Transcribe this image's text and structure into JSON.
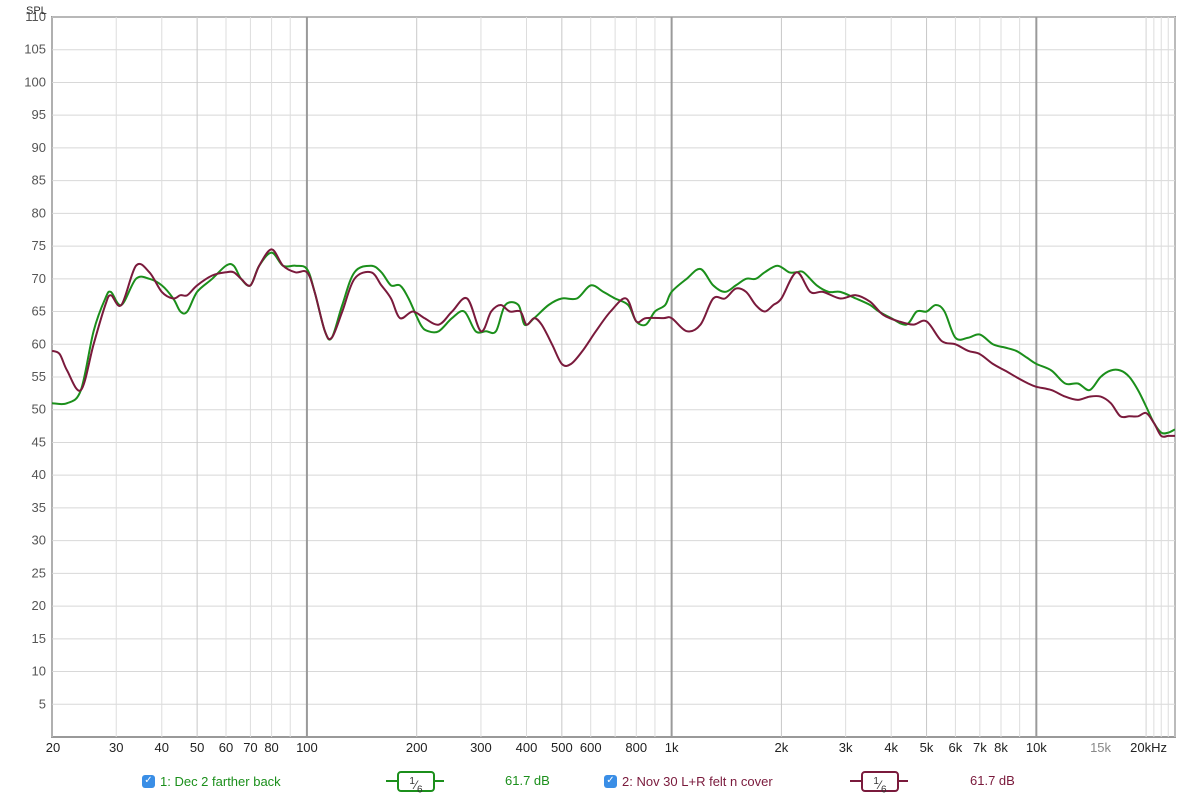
{
  "chart_data": {
    "type": "line",
    "ylabel": "SPL",
    "ylim": [
      0,
      110
    ],
    "xscale": "log",
    "xlim_hz": [
      20,
      20000
    ],
    "y_ticks": [
      "110",
      "105",
      "100",
      "95",
      "90",
      "85",
      "80",
      "75",
      "70",
      "65",
      "60",
      "55",
      "50",
      "45",
      "40",
      "35",
      "30",
      "25",
      "20",
      "15",
      "10",
      "5"
    ],
    "x_ticks": [
      {
        "f": 20,
        "label": "20",
        "minor": false
      },
      {
        "f": 30,
        "label": "30",
        "minor": false
      },
      {
        "f": 40,
        "label": "40",
        "minor": false
      },
      {
        "f": 50,
        "label": "50",
        "minor": false
      },
      {
        "f": 60,
        "label": "60",
        "minor": false
      },
      {
        "f": 70,
        "label": "70",
        "minor": false
      },
      {
        "f": 80,
        "label": "80",
        "minor": false
      },
      {
        "f": 100,
        "label": "100",
        "minor": false
      },
      {
        "f": 200,
        "label": "200",
        "minor": false
      },
      {
        "f": 300,
        "label": "300",
        "minor": false
      },
      {
        "f": 400,
        "label": "400",
        "minor": false
      },
      {
        "f": 500,
        "label": "500",
        "minor": false
      },
      {
        "f": 600,
        "label": "600",
        "minor": false
      },
      {
        "f": 800,
        "label": "800",
        "minor": false
      },
      {
        "f": 1000,
        "label": "1k",
        "minor": false
      },
      {
        "f": 2000,
        "label": "2k",
        "minor": false
      },
      {
        "f": 3000,
        "label": "3k",
        "minor": false
      },
      {
        "f": 4000,
        "label": "4k",
        "minor": false
      },
      {
        "f": 5000,
        "label": "5k",
        "minor": false
      },
      {
        "f": 6000,
        "label": "6k",
        "minor": false
      },
      {
        "f": 7000,
        "label": "7k",
        "minor": false
      },
      {
        "f": 8000,
        "label": "8k",
        "minor": false
      },
      {
        "f": 10000,
        "label": "10k",
        "minor": false
      },
      {
        "f": 15000,
        "label": "15k",
        "minor": true
      },
      {
        "f": 20000,
        "label": "20kHz",
        "minor": false
      }
    ],
    "grid": true,
    "series": [
      {
        "name": "1: Dec 2 farther back",
        "color": "#1b8f1b",
        "points": [
          [
            20,
            51
          ],
          [
            22,
            51
          ],
          [
            24,
            53
          ],
          [
            26,
            62
          ],
          [
            28,
            67
          ],
          [
            29,
            68
          ],
          [
            31,
            66
          ],
          [
            34,
            70
          ],
          [
            37,
            70
          ],
          [
            40,
            69
          ],
          [
            43,
            67
          ],
          [
            45,
            65
          ],
          [
            47,
            65
          ],
          [
            50,
            68
          ],
          [
            55,
            70
          ],
          [
            60,
            72
          ],
          [
            63,
            72
          ],
          [
            66,
            70
          ],
          [
            70,
            69
          ],
          [
            74,
            72
          ],
          [
            80,
            74
          ],
          [
            86,
            72
          ],
          [
            93,
            72
          ],
          [
            100,
            71.5
          ],
          [
            105,
            68
          ],
          [
            112,
            62
          ],
          [
            117,
            61
          ],
          [
            125,
            66
          ],
          [
            135,
            71
          ],
          [
            150,
            72
          ],
          [
            160,
            71
          ],
          [
            170,
            69
          ],
          [
            180,
            69
          ],
          [
            190,
            67
          ],
          [
            205,
            63
          ],
          [
            215,
            62
          ],
          [
            230,
            62
          ],
          [
            250,
            64
          ],
          [
            270,
            65
          ],
          [
            290,
            62
          ],
          [
            310,
            62
          ],
          [
            330,
            62
          ],
          [
            350,
            66
          ],
          [
            380,
            66
          ],
          [
            395,
            63
          ],
          [
            420,
            64
          ],
          [
            460,
            66
          ],
          [
            500,
            67
          ],
          [
            550,
            67
          ],
          [
            600,
            69
          ],
          [
            650,
            68
          ],
          [
            700,
            67
          ],
          [
            760,
            66
          ],
          [
            800,
            63.5
          ],
          [
            850,
            63
          ],
          [
            900,
            65
          ],
          [
            960,
            66
          ],
          [
            1000,
            68
          ],
          [
            1100,
            70
          ],
          [
            1200,
            71.5
          ],
          [
            1300,
            69
          ],
          [
            1400,
            68
          ],
          [
            1500,
            69
          ],
          [
            1600,
            70
          ],
          [
            1700,
            70
          ],
          [
            1800,
            71
          ],
          [
            1950,
            72
          ],
          [
            2100,
            71
          ],
          [
            2200,
            71
          ],
          [
            2300,
            71
          ],
          [
            2500,
            69
          ],
          [
            2700,
            68
          ],
          [
            2900,
            68
          ],
          [
            3200,
            67
          ],
          [
            3500,
            66
          ],
          [
            3700,
            65
          ],
          [
            4000,
            64
          ],
          [
            4400,
            63
          ],
          [
            4700,
            65
          ],
          [
            5000,
            65
          ],
          [
            5300,
            66
          ],
          [
            5600,
            65
          ],
          [
            6000,
            61
          ],
          [
            6500,
            61
          ],
          [
            7000,
            61.5
          ],
          [
            7600,
            60
          ],
          [
            8200,
            59.5
          ],
          [
            8800,
            59
          ],
          [
            9400,
            58
          ],
          [
            10000,
            57
          ],
          [
            11000,
            56
          ],
          [
            12000,
            54
          ],
          [
            13000,
            54
          ],
          [
            14000,
            53
          ],
          [
            15000,
            55
          ],
          [
            16000,
            56
          ],
          [
            17000,
            56
          ],
          [
            18000,
            55
          ],
          [
            19000,
            53
          ],
          [
            20000,
            50.5
          ],
          [
            21000,
            48
          ],
          [
            22000,
            46.5
          ],
          [
            23000,
            46.5
          ],
          [
            24000,
            47
          ]
        ]
      },
      {
        "name": "2: Nov 30 L+R felt n cover",
        "color": "#7a1a3c",
        "points": [
          [
            20,
            59
          ],
          [
            21,
            58.5
          ],
          [
            22,
            56
          ],
          [
            24,
            53
          ],
          [
            26,
            60
          ],
          [
            28,
            66
          ],
          [
            29,
            67.5
          ],
          [
            31,
            66
          ],
          [
            34,
            72
          ],
          [
            37,
            71
          ],
          [
            40,
            68
          ],
          [
            43,
            67
          ],
          [
            45,
            67.5
          ],
          [
            47,
            67.5
          ],
          [
            50,
            69
          ],
          [
            55,
            70.5
          ],
          [
            60,
            71
          ],
          [
            63,
            71
          ],
          [
            66,
            70
          ],
          [
            70,
            69
          ],
          [
            74,
            72
          ],
          [
            80,
            74.5
          ],
          [
            86,
            72
          ],
          [
            93,
            71
          ],
          [
            100,
            71
          ],
          [
            105,
            68
          ],
          [
            112,
            62
          ],
          [
            117,
            61
          ],
          [
            125,
            65
          ],
          [
            135,
            70
          ],
          [
            150,
            71
          ],
          [
            160,
            69
          ],
          [
            170,
            67
          ],
          [
            180,
            64
          ],
          [
            195,
            65
          ],
          [
            210,
            64
          ],
          [
            230,
            63
          ],
          [
            250,
            65
          ],
          [
            275,
            67
          ],
          [
            300,
            62
          ],
          [
            320,
            65
          ],
          [
            340,
            66
          ],
          [
            360,
            65
          ],
          [
            385,
            65
          ],
          [
            400,
            63
          ],
          [
            420,
            64
          ],
          [
            440,
            63
          ],
          [
            470,
            60
          ],
          [
            500,
            57
          ],
          [
            530,
            57
          ],
          [
            570,
            59
          ],
          [
            620,
            62
          ],
          [
            680,
            65
          ],
          [
            750,
            67
          ],
          [
            800,
            63.5
          ],
          [
            850,
            64
          ],
          [
            950,
            64
          ],
          [
            1000,
            64
          ],
          [
            1100,
            62
          ],
          [
            1200,
            63
          ],
          [
            1300,
            67
          ],
          [
            1400,
            67
          ],
          [
            1500,
            68.5
          ],
          [
            1600,
            68
          ],
          [
            1700,
            66
          ],
          [
            1800,
            65
          ],
          [
            1900,
            66
          ],
          [
            2000,
            67
          ],
          [
            2200,
            71
          ],
          [
            2400,
            68
          ],
          [
            2600,
            68
          ],
          [
            2900,
            67
          ],
          [
            3200,
            67.5
          ],
          [
            3500,
            66.5
          ],
          [
            3800,
            64.5
          ],
          [
            4200,
            63.5
          ],
          [
            4600,
            63
          ],
          [
            5000,
            63.5
          ],
          [
            5500,
            60.5
          ],
          [
            6000,
            60
          ],
          [
            6500,
            59
          ],
          [
            7000,
            58.5
          ],
          [
            7600,
            57
          ],
          [
            8200,
            56
          ],
          [
            8800,
            55
          ],
          [
            9500,
            54
          ],
          [
            10000,
            53.5
          ],
          [
            11000,
            53
          ],
          [
            12000,
            52
          ],
          [
            13000,
            51.5
          ],
          [
            14000,
            52
          ],
          [
            15000,
            52
          ],
          [
            16000,
            51
          ],
          [
            17000,
            49
          ],
          [
            18000,
            49
          ],
          [
            19000,
            49
          ],
          [
            20000,
            49.5
          ],
          [
            21000,
            48
          ],
          [
            22000,
            46
          ],
          [
            23000,
            46
          ],
          [
            24000,
            46
          ]
        ]
      }
    ]
  },
  "legend": [
    {
      "checked": true,
      "label": "1: Dec 2 farther back",
      "smoothing": "1/6",
      "smooth_num": "1",
      "smooth_den": "6",
      "level": "61.7 dB",
      "color": "#1b8f1b"
    },
    {
      "checked": true,
      "label": "2: Nov 30 L+R felt n cover",
      "smoothing": "1/6",
      "smooth_num": "1",
      "smooth_den": "6",
      "level": "61.7 dB",
      "color": "#7a1a3c"
    }
  ]
}
